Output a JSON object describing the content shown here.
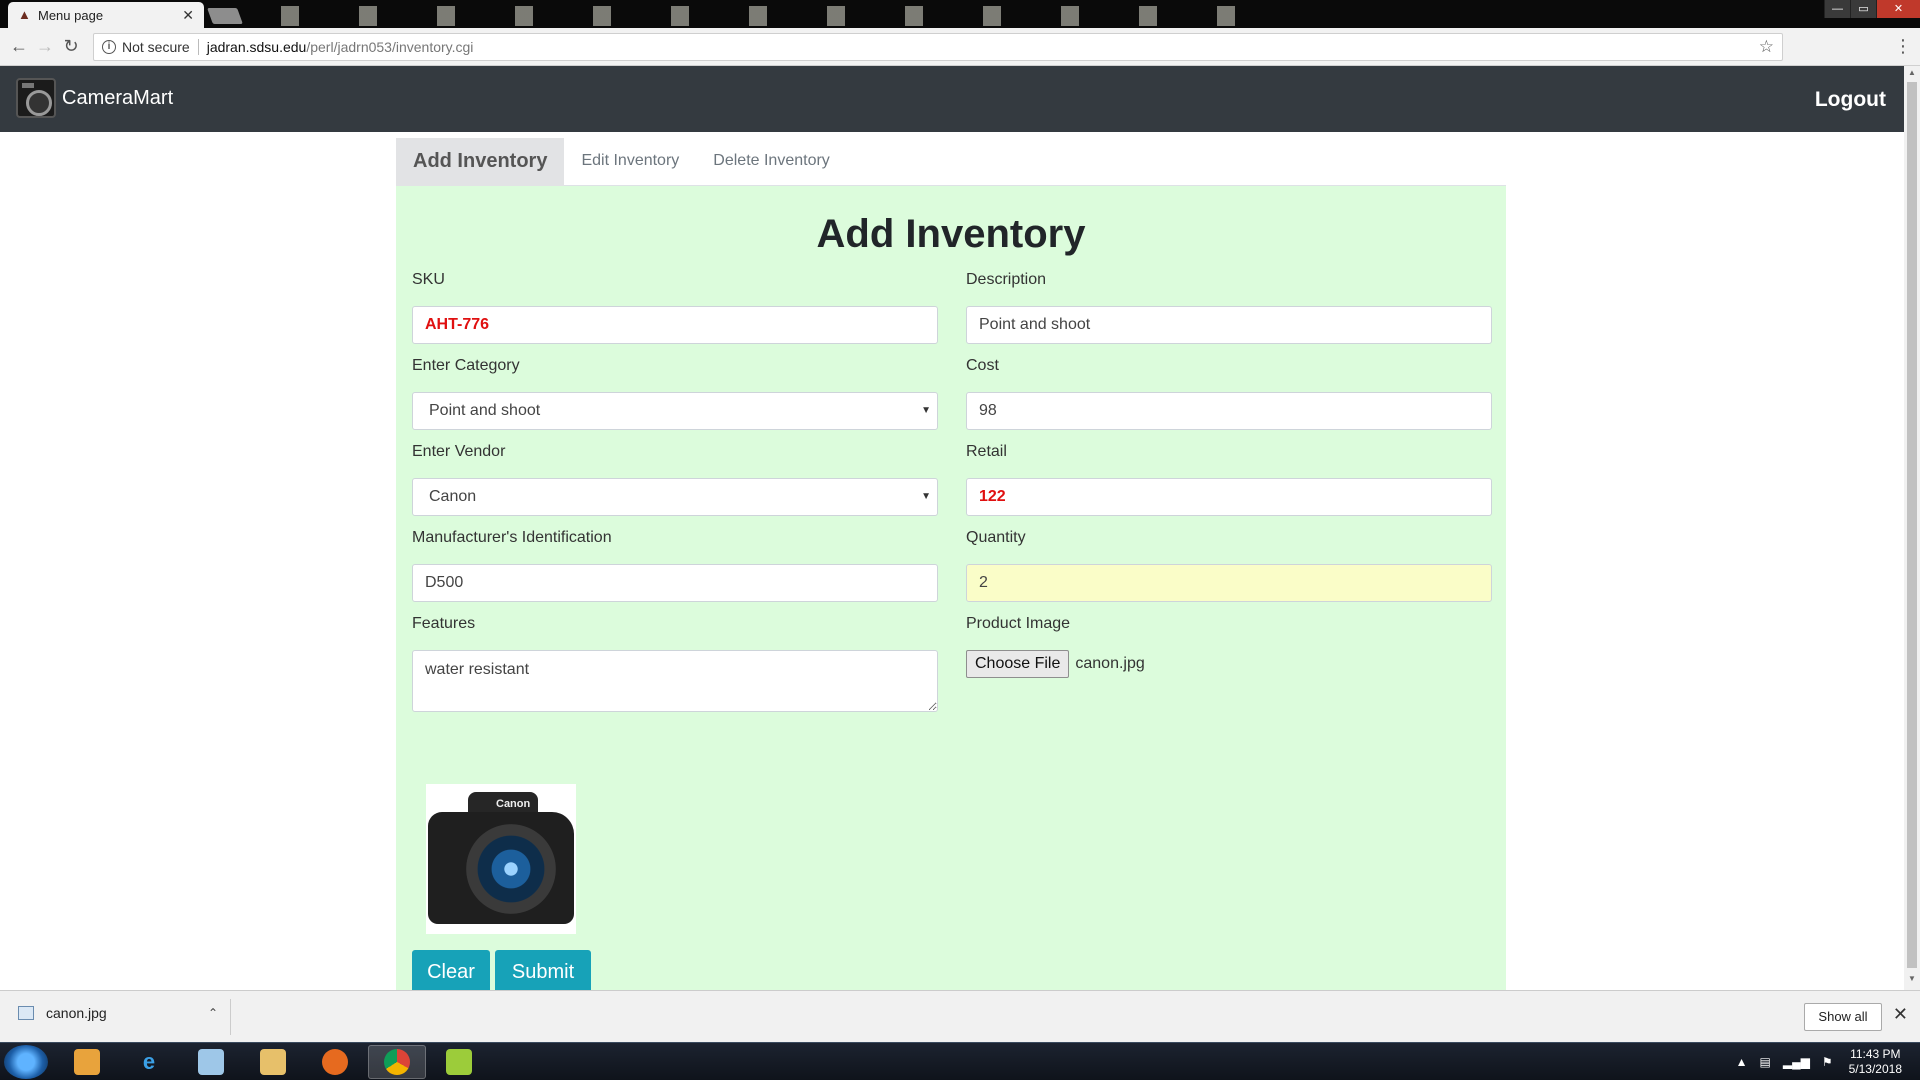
{
  "browser": {
    "tab_title": "Menu page",
    "tab_close": "✕",
    "security_label": "Not secure",
    "url_host": "jadran.sdsu.edu",
    "url_path": "/perl/jadrn053/inventory.cgi",
    "window_controls": [
      "—",
      "▭",
      "✕"
    ]
  },
  "navbar": {
    "brand": "CameraMart",
    "logout": "Logout"
  },
  "tabs": [
    {
      "label": "Add Inventory",
      "active": true
    },
    {
      "label": "Edit Inventory",
      "active": false
    },
    {
      "label": "Delete Inventory",
      "active": false
    }
  ],
  "form": {
    "heading": "Add Inventory",
    "sku": {
      "label": "SKU",
      "value": "AHT-776"
    },
    "description": {
      "label": "Description",
      "value": "Point and shoot"
    },
    "category": {
      "label": "Enter Category",
      "value": "Point and shoot"
    },
    "cost": {
      "label": "Cost",
      "value": "98"
    },
    "vendor": {
      "label": "Enter Vendor",
      "value": "Canon"
    },
    "retail": {
      "label": "Retail",
      "value": "122"
    },
    "manufacturer_id": {
      "label": "Manufacturer's Identification",
      "value": "D500"
    },
    "quantity": {
      "label": "Quantity",
      "value": "2"
    },
    "features": {
      "label": "Features",
      "value": "water resistant"
    },
    "product_image": {
      "label": "Product Image",
      "button": "Choose File",
      "filename": "canon.jpg"
    },
    "preview_brand": "Canon",
    "clear_label": "Clear",
    "submit_label": "Submit"
  },
  "downloads": {
    "file": "canon.jpg",
    "show_all": "Show all"
  },
  "taskbar": {
    "time": "11:43 PM",
    "date": "5/13/2018"
  },
  "colors": {
    "navbar_bg": "#343a40",
    "panel_bg": "#dcfcdc",
    "button_bg": "#17a2b8",
    "error_text": "#e01010",
    "quantity_bg": "#fafdc8"
  }
}
